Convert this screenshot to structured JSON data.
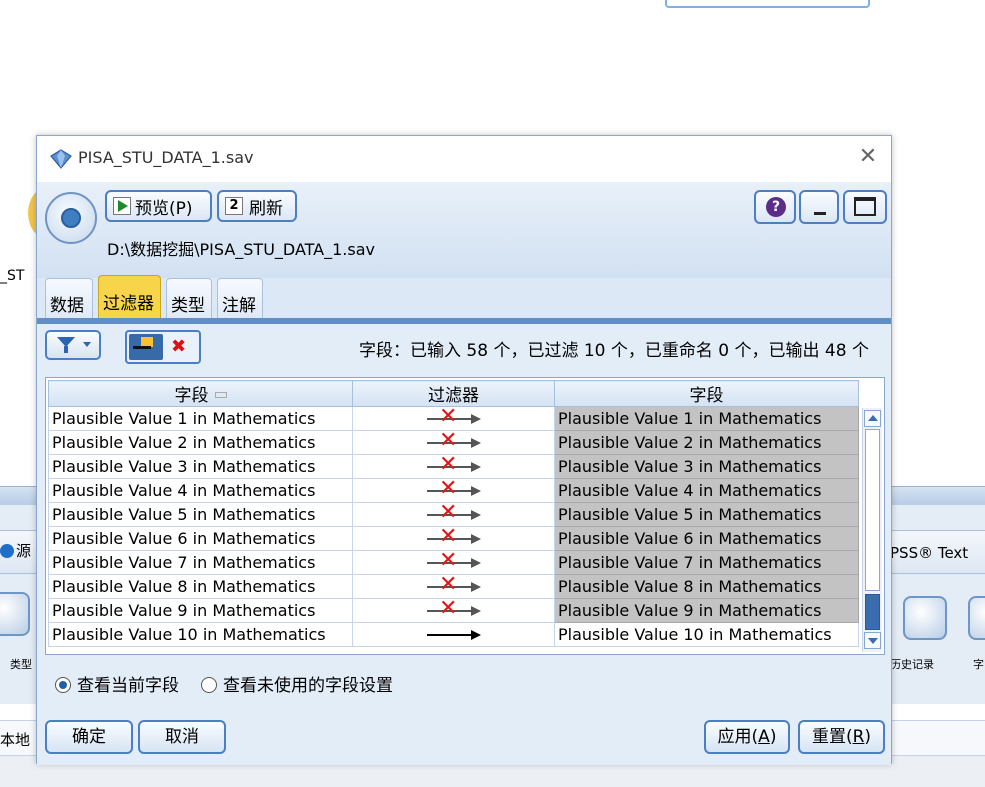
{
  "background": {
    "left_fragment": "_ST",
    "tab_left": "源",
    "tab_right": "PSS® Text",
    "node_left_label": "类型",
    "node_right_label_1": "历史记录",
    "node_right_label_2": "字",
    "bottom_left": "本地"
  },
  "dialog": {
    "title": "PISA_STU_DATA_1.sav",
    "close_icon": "close-icon",
    "toolbar": {
      "preview_label": "预览(P)",
      "refresh_label": "刷新"
    },
    "path": "D:\\数据挖掘\\PISA_STU_DATA_1.sav",
    "window_buttons": {
      "help": "?",
      "help_icon": "help-icon",
      "minimize_icon": "minimize-icon",
      "maximize_icon": "maximize-icon"
    },
    "tabs": [
      "数据",
      "过滤器",
      "类型",
      "注解"
    ],
    "active_tab": "过滤器",
    "field_summary": "字段：已输入 58 个，已过滤 10 个，已重命名 0 个，已输出 48 个",
    "table": {
      "headers": [
        "字段",
        "过滤器",
        "字段"
      ],
      "rows": [
        {
          "field": "Plausible Value 1 in Mathematics",
          "filtered": true,
          "output": "Plausible Value 1 in Mathematics"
        },
        {
          "field": "Plausible Value 2 in Mathematics",
          "filtered": true,
          "output": "Plausible Value 2 in Mathematics"
        },
        {
          "field": "Plausible Value 3 in Mathematics",
          "filtered": true,
          "output": "Plausible Value 3 in Mathematics"
        },
        {
          "field": "Plausible Value 4 in Mathematics",
          "filtered": true,
          "output": "Plausible Value 4 in Mathematics"
        },
        {
          "field": "Plausible Value 5 in Mathematics",
          "filtered": true,
          "output": "Plausible Value 5 in Mathematics"
        },
        {
          "field": "Plausible Value 6 in Mathematics",
          "filtered": true,
          "output": "Plausible Value 6 in Mathematics"
        },
        {
          "field": "Plausible Value 7 in Mathematics",
          "filtered": true,
          "output": "Plausible Value 7 in Mathematics"
        },
        {
          "field": "Plausible Value 8 in Mathematics",
          "filtered": true,
          "output": "Plausible Value 8 in Mathematics"
        },
        {
          "field": "Plausible Value 9 in Mathematics",
          "filtered": true,
          "output": "Plausible Value 9 in Mathematics"
        },
        {
          "field": "Plausible Value 10 in Mathematics",
          "filtered": false,
          "output": "Plausible Value 10 in Mathematics"
        }
      ]
    },
    "view_options": {
      "current": "查看当前字段",
      "unused": "查看未使用的字段设置",
      "selected": "current"
    },
    "buttons": {
      "ok": "确定",
      "cancel": "取消",
      "apply_text": "应用(",
      "apply_key": "A",
      "apply_end": ")",
      "reset_text": "重置(",
      "reset_key": "R",
      "reset_end": ")"
    },
    "colors": {
      "active_tab": "#f7d44a",
      "filtered_output_bg": "#c3c3c3",
      "filter_x": "#e01818",
      "accent_border": "#4b7fc3"
    }
  }
}
